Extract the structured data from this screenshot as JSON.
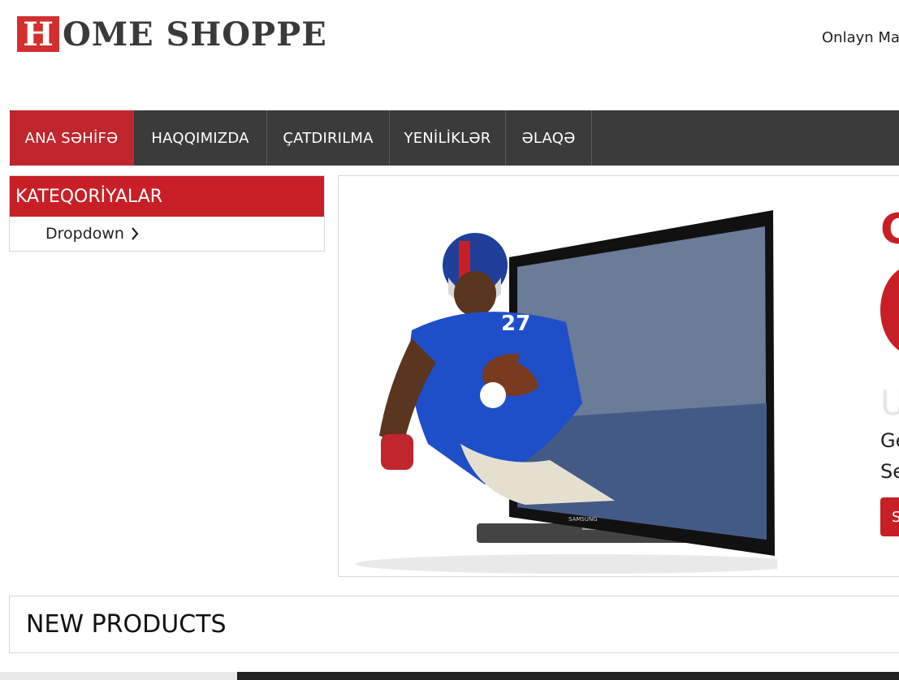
{
  "logo": {
    "letter": "H",
    "text": "OME SHOPPE"
  },
  "header": {
    "right_text": "Onlayn Ma"
  },
  "nav": [
    {
      "label": "ANA SƏHİFƏ",
      "active": true
    },
    {
      "label": "HAQQIMIZDA",
      "active": false
    },
    {
      "label": "ÇATDIRILMA",
      "active": false
    },
    {
      "label": "YENİLİKLƏR",
      "active": false
    },
    {
      "label": "ƏLAQƏ",
      "active": false
    }
  ],
  "categories": {
    "title": "KATEQORİYALAR",
    "items": [
      {
        "label": "Dropdown"
      }
    ]
  },
  "banner": {
    "title_fragment": "C",
    "faint_fragment": "U",
    "line1": "Ge",
    "line2": "Se",
    "button": "S"
  },
  "sections": {
    "new_products": "NEW PRODUCTS"
  },
  "colors": {
    "accent": "#c81f26",
    "nav_bg": "#3b3b3b"
  }
}
